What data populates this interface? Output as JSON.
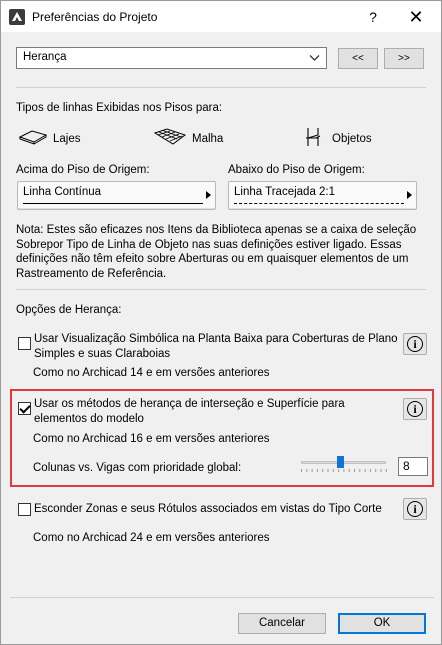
{
  "window": {
    "title": "Preferências do Projeto",
    "help": "?",
    "close": "✕"
  },
  "top_select": {
    "value": "Herança",
    "prev_label": "<<",
    "next_label": ">>"
  },
  "line_types": {
    "heading": "Tipos de linhas Exibidas nos Pisos para:",
    "items": [
      {
        "label": "Lajes",
        "icon": "slab-icon"
      },
      {
        "label": "Malha",
        "icon": "mesh-icon"
      },
      {
        "label": "Objetos",
        "icon": "chair-object-icon"
      }
    ],
    "above_label": "Acima do Piso de Origem:",
    "above_value": "Linha Contínua",
    "below_label": "Abaixo do Piso de Origem:",
    "below_value": "Linha Tracejada 2:1",
    "note": [
      "Nota: Estes são eficazes nos Itens da Biblioteca apenas se a caixa de seleção",
      "Sobrepor Tipo de Linha de Objeto nas suas definições estiver ligado. Essas",
      "definições não têm efeito sobre Aberturas ou em quaisquer elementos de um",
      "Rastreamento de Referência."
    ]
  },
  "inheritance": {
    "heading": "Opções de Herança:",
    "option1": {
      "checked": false,
      "line1": "Usar Visualização Simbólica na Planta Baixa para Coberturas de Plano",
      "line2": "Simples e suas Claraboias",
      "note": "Como no Archicad 14 e em versões anteriores"
    },
    "option2": {
      "checked": true,
      "line1": "Usar os métodos de herança de interseção e Superfície para",
      "line2": "elementos do modelo",
      "note": "Como no Archicad 16 e em versões anteriores",
      "priority_label": "Colunas vs. Vigas com prioridade global:",
      "priority_value": "8",
      "priority_fraction": 0.47
    },
    "option3": {
      "checked": false,
      "line1": "Esconder Zonas e seus Rótulos associados em vistas do Tipo Corte",
      "note": "Como no Archicad 24 e em versões anteriores"
    },
    "info_glyph": "i"
  },
  "buttons": {
    "cancel": "Cancelar",
    "ok": "OK"
  },
  "colors": {
    "highlight": "#e23a3a",
    "accent": "#1173d8"
  }
}
